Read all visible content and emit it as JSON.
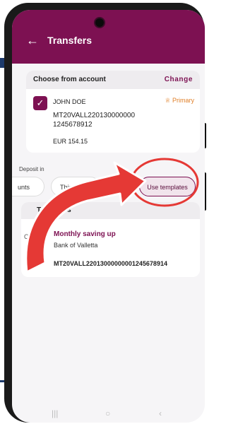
{
  "header": {
    "title": "Transfers",
    "back_icon": "arrow-left-icon"
  },
  "account_card": {
    "header_label": "Choose from account",
    "change_label": "Change",
    "holder_name": "JOHN DOE",
    "primary_label": "Primary",
    "account_number": "MT20VALL220130000000 1245678912",
    "balance": "EUR  154.15"
  },
  "deposit": {
    "label": "Deposit in",
    "chips": [
      "unts",
      "Third",
      "Use templates"
    ]
  },
  "templates": {
    "header_label": "Templates",
    "items": [
      {
        "badge": "O",
        "name": "Monthly saving up",
        "bank": "Bank of Valletta",
        "iban": "MT20VALL22013000000001245678914"
      }
    ]
  },
  "colors": {
    "brand": "#7d1152",
    "primary_accent": "#e0802a",
    "annotation": "#e53935"
  }
}
